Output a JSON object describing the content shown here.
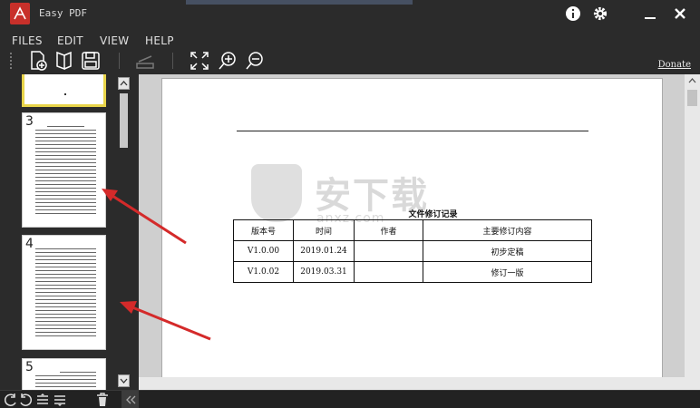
{
  "app": {
    "title": "Easy PDF"
  },
  "menu": {
    "items": [
      "FILES",
      "EDIT",
      "VIEW",
      "HELP"
    ]
  },
  "toolbar": {
    "donate_label": "Donate"
  },
  "thumbnails": [
    {
      "number": "",
      "selected": true
    },
    {
      "number": "3",
      "selected": false
    },
    {
      "number": "4",
      "selected": false
    },
    {
      "number": "5",
      "selected": false
    }
  ],
  "document": {
    "title": "文件修订记录",
    "table": {
      "headers": [
        "版本号",
        "时间",
        "作者",
        "主要修订内容"
      ],
      "rows": [
        [
          "V1.0.00",
          "2019.01.24",
          "",
          "初步定稿"
        ],
        [
          "V1.0.02",
          "2019.03.31",
          "",
          "修订一版"
        ]
      ]
    },
    "watermark": {
      "text": "安下载",
      "sub": "anxz.com"
    }
  },
  "colors": {
    "accent": "#e8d449",
    "logo": "#c8302a",
    "arrow": "#d42a2a"
  },
  "icons": [
    "pdf-logo-icon",
    "info-icon",
    "gear-icon",
    "minimize-icon",
    "close-icon",
    "new-document-icon",
    "open-book-icon",
    "save-icon",
    "scanner-icon",
    "fit-screen-icon",
    "zoom-in-icon",
    "zoom-out-icon",
    "rotate-left-icon",
    "rotate-right-icon",
    "align-icon",
    "list-icon",
    "trash-icon",
    "collapse-icon"
  ]
}
